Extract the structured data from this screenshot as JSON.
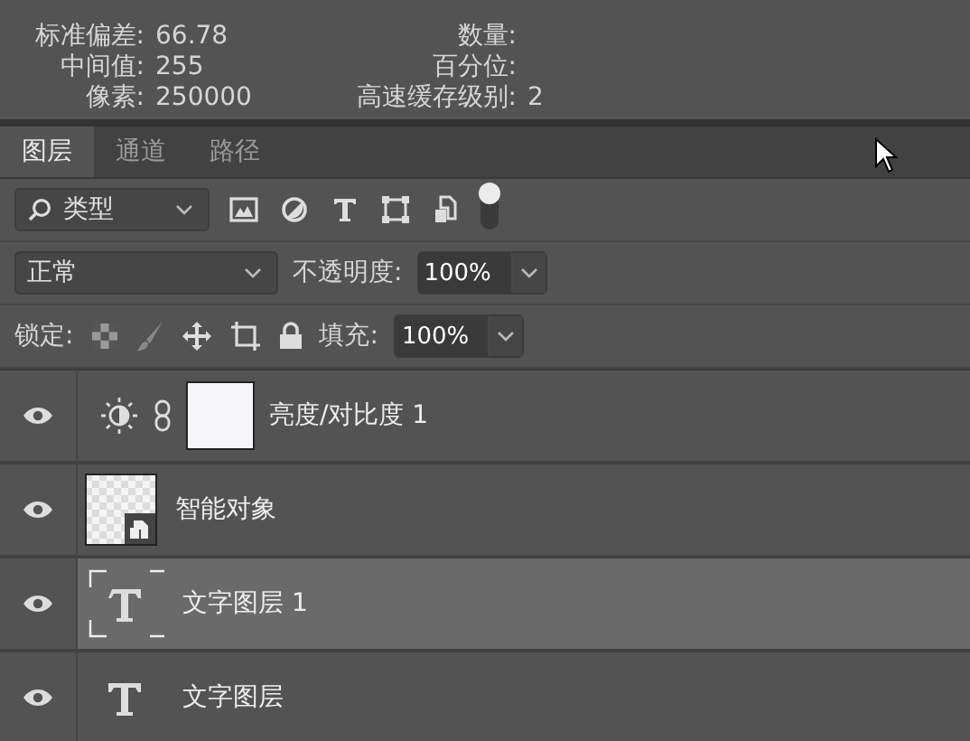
{
  "stats": [
    {
      "label": "标准偏差:",
      "value": "66.78",
      "label_2": "数量:"
    },
    {
      "label": "中间值:",
      "value": "255",
      "label_2": "百分位:"
    },
    {
      "label": "像素:",
      "value": "250000",
      "label_2": "高速缓存级别:",
      "value_2": "2"
    }
  ],
  "tabs": [
    {
      "label": "图层",
      "selected": true
    },
    {
      "label": "通道",
      "selected": false
    },
    {
      "label": "路径",
      "selected": false
    }
  ],
  "filter": {
    "value": "类型",
    "toggle_on": true
  },
  "blend": {
    "value": "正常",
    "opacity_label": "不透明度:",
    "opacity": "100%"
  },
  "lock": {
    "label": "锁定:",
    "fill_label": "填充:",
    "fill": "100%"
  },
  "layers": [
    {
      "kind": "adjustment",
      "name": "亮度/对比度 1",
      "visible": true,
      "selected": false
    },
    {
      "kind": "smart",
      "name": "智能对象",
      "visible": true,
      "selected": false
    },
    {
      "kind": "text",
      "name": "文字图层 1",
      "visible": true,
      "selected": true
    },
    {
      "kind": "text",
      "name": "文字图层",
      "visible": true,
      "selected": false
    }
  ]
}
